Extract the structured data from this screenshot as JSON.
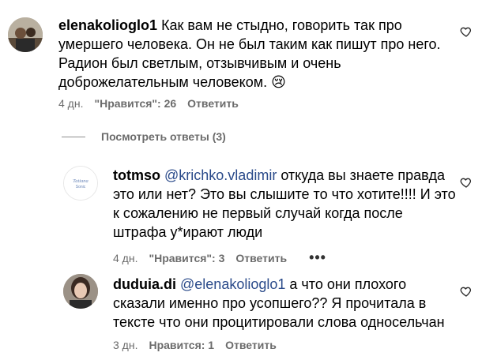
{
  "comments": [
    {
      "username": "elenakolioglo1",
      "text": "Как вам не стыдно, говорить так про умершего человека. Он не был таким как пишут про него. Радион был светлым, отзывчивым и очень доброжелательным человеком.",
      "line1": "Как вам не стыдно, говорить так про",
      "line2": "умершего человека. Он не был таким как пишут про него.",
      "line3": "Радион был светлым, отзывчивым и очень",
      "line4": "доброжелательным человеком.",
      "emoji": "😢",
      "time": "4 дн.",
      "likes": "\"Нравится\": 26",
      "reply": "Ответить"
    },
    {
      "username": "totmso",
      "mention": "@krichko.vladimir",
      "line1": " откуда вы знаете правда",
      "line2": "это или нет? Это вы слышите то что хотите!!!! И это",
      "line3": "к сожалению не первый случай когда после",
      "line4": "штрафа у*ирают люди",
      "time": "4 дн.",
      "likes": "\"Нравится\": 3",
      "reply": "Ответить",
      "more": "•••",
      "avatar_text_1": "Tatiana",
      "avatar_text_2": "Sonic"
    },
    {
      "username": "duduia.di",
      "mention": "@elenakolioglo1",
      "line1": " а что они плохого",
      "line2": "сказали именно про усопшего?? Я прочитала в",
      "line3": "тексте что они процитировали слова односельчан",
      "time": "3 дн.",
      "likes": "Нравится: 1",
      "reply": "Ответить"
    }
  ],
  "view_replies": "Посмотреть ответы (3)",
  "colors": {
    "mention": "#2a4a8a",
    "meta": "#6b6b6b",
    "heart": "#262626"
  },
  "icons": {
    "like": "heart-outline-icon"
  }
}
